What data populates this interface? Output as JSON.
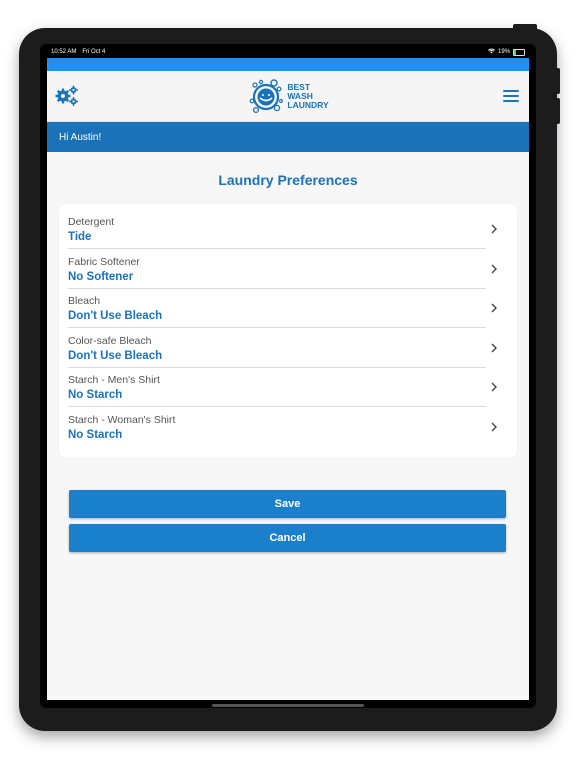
{
  "status_bar": {
    "time": "10:52 AM",
    "date": "Fri Oct 4",
    "battery": "19%",
    "battery_level": 0.19
  },
  "header": {
    "logo_lines": [
      "BEST",
      "WASH",
      "LAUNDRY"
    ],
    "settings_icon": "gears-icon",
    "menu_icon": "hamburger-menu-icon"
  },
  "greeting": "Hi Austin!",
  "page_title": "Laundry Preferences",
  "preferences": [
    {
      "label": "Detergent",
      "value": "Tide"
    },
    {
      "label": "Fabric Softener",
      "value": "No Softener"
    },
    {
      "label": "Bleach",
      "value": "Don't Use Bleach"
    },
    {
      "label": "Color-safe Bleach",
      "value": "Don't Use Bleach"
    },
    {
      "label": "Starch - Men's Shirt",
      "value": "No Starch"
    },
    {
      "label": "Starch - Woman's Shirt",
      "value": "No Starch"
    }
  ],
  "buttons": {
    "save": "Save",
    "cancel": "Cancel"
  },
  "colors": {
    "brand_blue": "#1a73b8",
    "button_blue": "#1a80cc",
    "top_strip": "#1e90f5"
  }
}
